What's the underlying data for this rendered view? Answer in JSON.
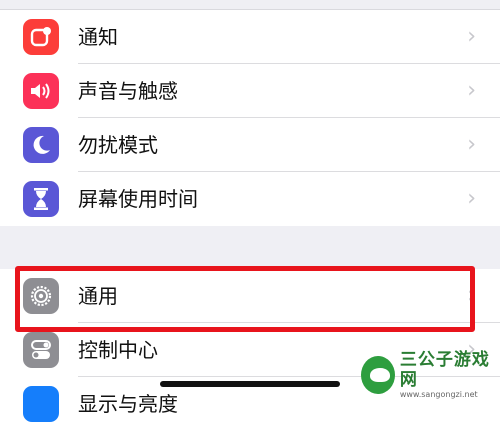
{
  "group1": {
    "items": [
      {
        "label": "通知",
        "icon": "notifications-icon",
        "color": "#fc3d39"
      },
      {
        "label": "声音与触感",
        "icon": "speaker-icon",
        "color": "#fc3158"
      },
      {
        "label": "勿扰模式",
        "icon": "moon-icon",
        "color": "#5a57d6"
      },
      {
        "label": "屏幕使用时间",
        "icon": "hourglass-icon",
        "color": "#5a57d6"
      }
    ]
  },
  "group2": {
    "items": [
      {
        "label": "通用",
        "icon": "gear-icon",
        "color": "#8e8e93"
      },
      {
        "label": "控制中心",
        "icon": "toggles-icon",
        "color": "#8e8e93"
      },
      {
        "label": "显示与亮度",
        "icon": "display-icon",
        "color": "#157efb"
      }
    ]
  },
  "chevron": "›",
  "highlight_color": "#e8141c",
  "watermark": {
    "title": "三公子游戏网",
    "url": "www.sangongzi.net"
  }
}
